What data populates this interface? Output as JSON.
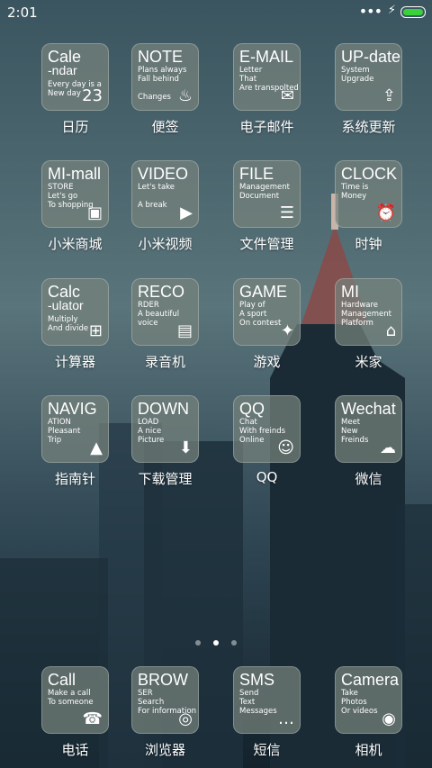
{
  "status": {
    "time": "2:01",
    "signal": "•••",
    "charging": "⚡"
  },
  "apps": [
    {
      "label": "日历",
      "big": "Cale",
      "big2": "-ndar",
      "lines": [
        "Every day is a",
        "New day"
      ],
      "icon": "calendar-icon",
      "glyph": "23"
    },
    {
      "label": "便签",
      "big": "NOTE",
      "lines": [
        "Plans always",
        "Fall behind",
        "",
        "Changes"
      ],
      "icon": "tag-icon",
      "glyph": "♨"
    },
    {
      "label": "电子邮件",
      "big": "E-MAIL",
      "lines": [
        "Letter",
        "That",
        "Are transpolted"
      ],
      "icon": "envelope-icon",
      "glyph": "✉"
    },
    {
      "label": "系统更新",
      "big": "UP-date",
      "lines": [
        "System",
        "Upgrade"
      ],
      "icon": "upgrade-icon",
      "glyph": "⇪"
    },
    {
      "label": "小米商城",
      "big": "MI-mall",
      "lines": [
        "STORE",
        "Let's go",
        "To shopping"
      ],
      "icon": "shopping-bag-icon",
      "glyph": "▣"
    },
    {
      "label": "小米视频",
      "big": "VIDEO",
      "lines": [
        "Let's take",
        "",
        "A break"
      ],
      "icon": "film-icon",
      "glyph": "▶"
    },
    {
      "label": "文件管理",
      "big": "FILE",
      "lines": [
        "Management",
        "Document"
      ],
      "icon": "inbox-tray-icon",
      "glyph": "☰"
    },
    {
      "label": "时钟",
      "big": "CLOCK",
      "lines": [
        "Time is",
        "Money"
      ],
      "icon": "alarm-clock-icon",
      "glyph": "⏰"
    },
    {
      "label": "计算器",
      "big": "Calc",
      "big2": "-ulator",
      "lines": [
        "Multiply",
        "And divide"
      ],
      "icon": "calculator-icon",
      "glyph": "⊞"
    },
    {
      "label": "录音机",
      "big": "RECO",
      "lines": [
        "RDER",
        "A beautiful voice"
      ],
      "icon": "cassette-icon",
      "glyph": "▤"
    },
    {
      "label": "游戏",
      "big": "GAME",
      "lines": [
        "Play of",
        "A sport",
        "On contest"
      ],
      "icon": "gamepad-icon",
      "glyph": "✦"
    },
    {
      "label": "米家",
      "big": "MI",
      "lines": [
        "Hardware",
        "Management",
        "Platform"
      ],
      "icon": "mijia-home-icon",
      "glyph": "⌂"
    },
    {
      "label": "指南针",
      "big": "NAVIG",
      "lines": [
        "ATION",
        "Pleasant",
        "Trip"
      ],
      "icon": "navigation-arrow-icon",
      "glyph": "▲"
    },
    {
      "label": "下载管理",
      "big": "DOWN",
      "lines": [
        "LOAD",
        "A nice",
        "Picture"
      ],
      "icon": "download-icon",
      "glyph": "⬇"
    },
    {
      "label": "QQ",
      "big": "QQ",
      "lines": [
        "Chat",
        "With freinds",
        "Online"
      ],
      "icon": "penguin-icon",
      "glyph": "☺"
    },
    {
      "label": "微信",
      "big": "Wechat",
      "lines": [
        "Meet",
        "New",
        "Freinds"
      ],
      "icon": "chat-bubbles-icon",
      "glyph": "☁"
    },
    {
      "label": "电话",
      "big": "Call",
      "lines": [
        "Make a call",
        "To someone"
      ],
      "icon": "phone-icon",
      "glyph": "☎"
    },
    {
      "label": "浏览器",
      "big": "BROW",
      "lines": [
        "SER",
        "Search",
        "For information"
      ],
      "icon": "browser-compass-icon",
      "glyph": "◎"
    },
    {
      "label": "短信",
      "big": "SMS",
      "lines": [
        "Send",
        "Text",
        "Messages"
      ],
      "icon": "message-bubble-icon",
      "glyph": "…"
    },
    {
      "label": "相机",
      "big": "Camera",
      "lines": [
        "Take",
        "Photos",
        "Or videos"
      ],
      "icon": "camera-icon",
      "glyph": "◉"
    }
  ],
  "pager": {
    "pages": 3,
    "current": 2
  }
}
